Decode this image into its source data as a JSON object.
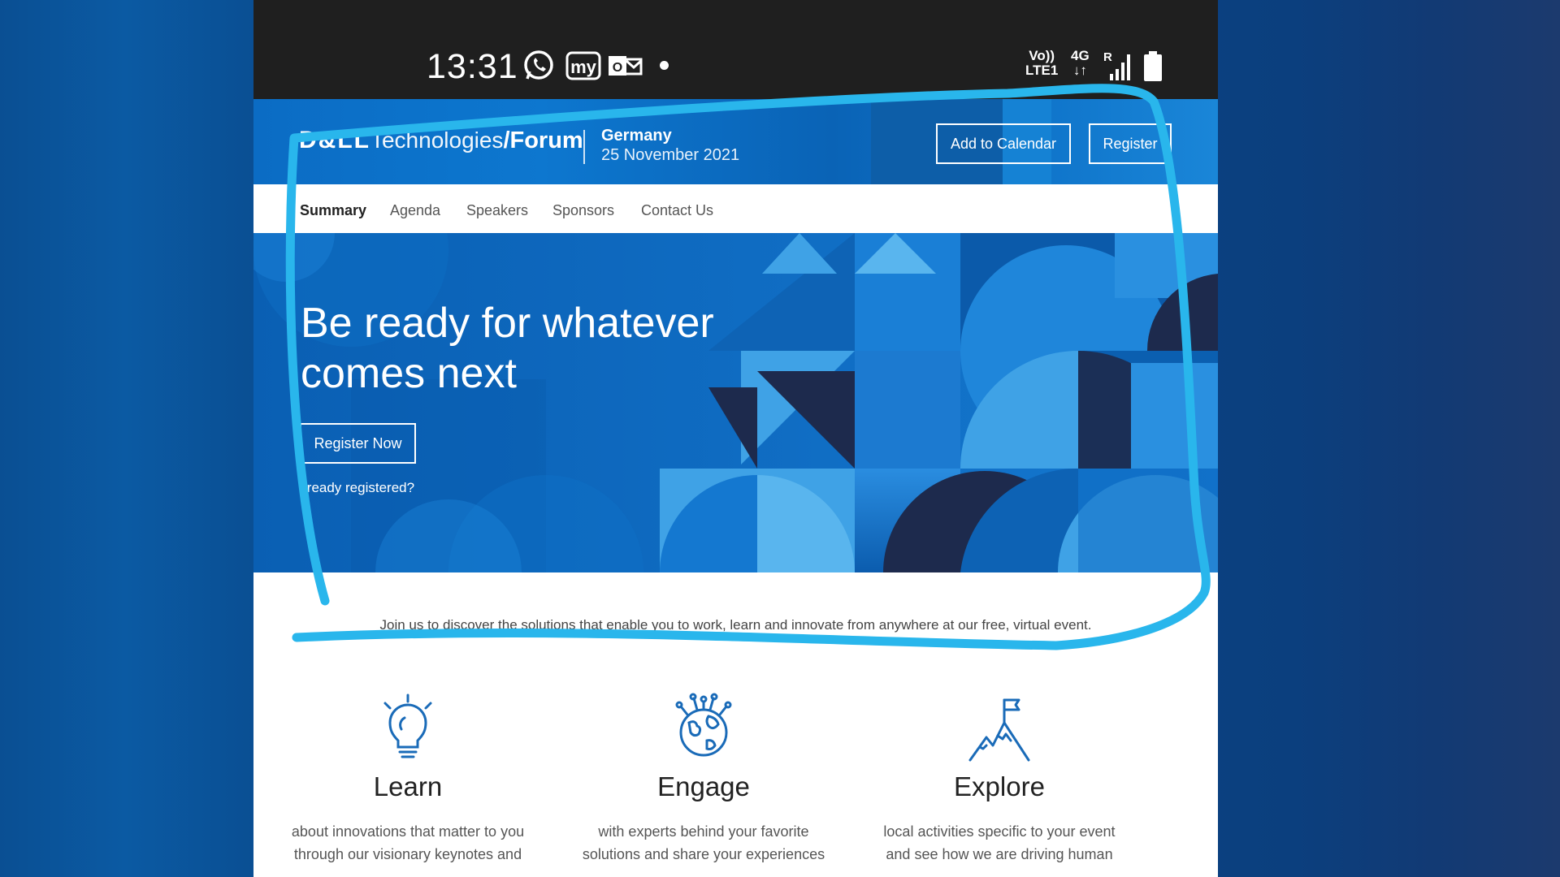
{
  "status_bar": {
    "time": "13:31",
    "icons": [
      "whatsapp-icon",
      "my-app-icon",
      "outlook-icon",
      "dot-icon",
      "volte-icon",
      "4g-icon",
      "signal-icon",
      "battery-icon"
    ],
    "volte_line1": "Vo))",
    "volte_line2": "LTE1",
    "network": "4G",
    "roaming": "R"
  },
  "header": {
    "logo_dell": "D&LL",
    "logo_tech": "Technologies",
    "logo_forum": "/Forum",
    "country": "Germany",
    "date": "25 November 2021",
    "add_to_calendar": "Add to Calendar",
    "register": "Register"
  },
  "nav": {
    "items": [
      "Summary",
      "Agenda",
      "Speakers",
      "Sponsors",
      "Contact Us"
    ],
    "active": "Summary"
  },
  "hero": {
    "title": "Be ready for whatever comes next",
    "register_now": "Register Now",
    "already_registered": "lready registered?"
  },
  "intro": "Join us to discover the solutions that enable you to work, learn and innovate from anywhere at our free, virtual event.",
  "features": [
    {
      "icon": "lightbulb-icon",
      "title": "Learn",
      "line1": "about innovations that matter to you",
      "line2": "through our visionary keynotes and"
    },
    {
      "icon": "globe-network-icon",
      "title": "Engage",
      "line1": "with experts behind your favorite",
      "line2": "solutions and share your experiences"
    },
    {
      "icon": "mountain-flag-icon",
      "title": "Explore",
      "line1": "local activities specific to your event",
      "line2": "and see how we are driving human"
    }
  ],
  "colors": {
    "page_background": "#0b4f93",
    "header_blue": "#0b6cc4",
    "hero_blue": "#0a67bd",
    "dark_navy": "#1d2a4d",
    "light_blue": "#3fa2e6",
    "annotation_cyan": "#29b6ec",
    "icon_blue": "#1a6bb8"
  }
}
